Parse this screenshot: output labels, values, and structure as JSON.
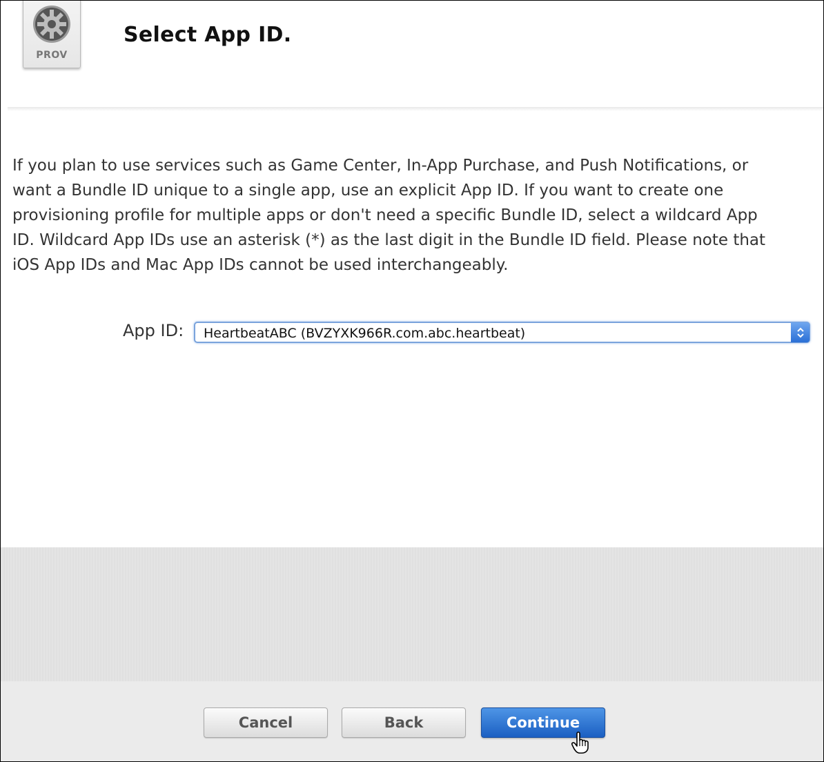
{
  "header": {
    "icon_name": "provisioning-profile-gear-icon",
    "icon_label": "PROV",
    "title": "Select App ID."
  },
  "description": "If you plan to use services such as Game Center, In-App Purchase, and Push Notifications, or want a Bundle ID unique to a single app, use an explicit App ID. If you want to create one provisioning profile for multiple apps or don't need a specific Bundle ID, select a wildcard App ID. Wildcard App IDs use an asterisk (*) as the last digit in the Bundle ID field. Please note that iOS App IDs and Mac App IDs cannot be used interchangeably.",
  "form": {
    "app_id_label": "App ID:",
    "app_id_selected": "HeartbeatABC (BVZYXK966R.com.abc.heartbeat)"
  },
  "buttons": {
    "cancel": "Cancel",
    "back": "Back",
    "continue": "Continue"
  },
  "colors": {
    "primary_button": "#1b5fc2",
    "select_focus": "#7aa3dc"
  }
}
